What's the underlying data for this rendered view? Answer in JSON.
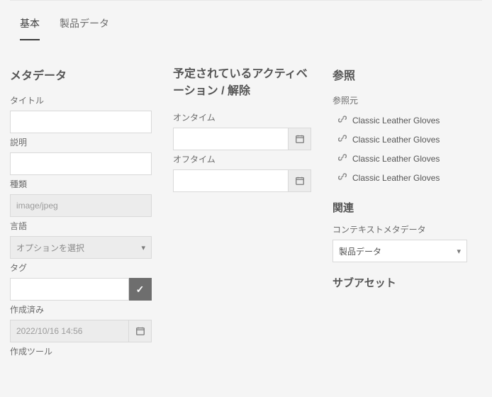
{
  "tabs": {
    "basic": "基本",
    "product": "製品データ"
  },
  "col_left": {
    "heading": "メタデータ",
    "title_label": "タイトル",
    "title_value": "",
    "desc_label": "説明",
    "desc_value": "",
    "type_label": "種類",
    "type_value": "image/jpeg",
    "lang_label": "言語",
    "lang_placeholder": "オプションを選択",
    "tags_label": "タグ",
    "tags_value": "",
    "created_label": "作成済み",
    "created_value": "2022/10/16 14:56",
    "tool_label": "作成ツール"
  },
  "col_mid": {
    "heading": "予定されているアクティベーション / 解除",
    "ontime_label": "オンタイム",
    "ontime_value": "",
    "offtime_label": "オフタイム",
    "offtime_value": ""
  },
  "col_right": {
    "heading": "参照",
    "referrers_label": "参照元",
    "refs": [
      "Classic Leather Gloves",
      "Classic Leather Gloves",
      "Classic Leather Gloves",
      "Classic Leather Gloves"
    ],
    "related_heading": "関連",
    "context_label": "コンテキストメタデータ",
    "context_value": "製品データ",
    "subasset_heading": "サブアセット"
  }
}
